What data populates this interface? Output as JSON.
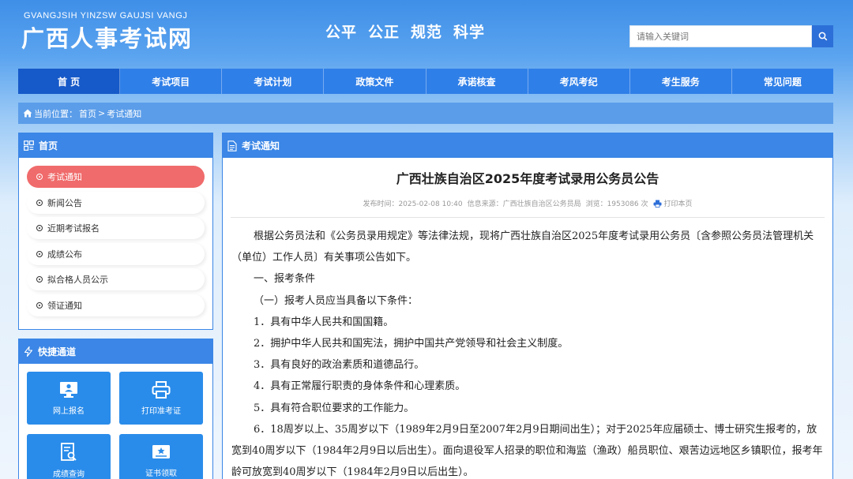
{
  "header": {
    "logo_en": "GVANGJSIH YINZSW GAUJSI VANGJ",
    "logo_cn": "广西人事考试网",
    "slogans": [
      "公平",
      "公正",
      "规范",
      "科学"
    ],
    "search_placeholder": "请输入关键词"
  },
  "nav": {
    "items": [
      "首 页",
      "考试项目",
      "考试计划",
      "政策文件",
      "承诺核查",
      "考风考纪",
      "考生服务",
      "常见问题"
    ],
    "active_index": 0
  },
  "breadcrumb": {
    "prefix": "当前位置：",
    "home": "首页",
    "sep": ">",
    "current": "考试通知"
  },
  "sidebar": {
    "title": "首页",
    "items": [
      "考试通知",
      "新闻公告",
      "近期考试报名",
      "成绩公布",
      "拟合格人员公示",
      "领证通知"
    ],
    "active_index": 0
  },
  "quick": {
    "title": "快捷通道",
    "items": [
      {
        "label": "网上报名",
        "icon": "monitor-user-icon"
      },
      {
        "label": "打印准考证",
        "icon": "printer-icon"
      },
      {
        "label": "成绩查询",
        "icon": "document-search-icon"
      },
      {
        "label": "证书领取",
        "icon": "certificate-icon"
      }
    ]
  },
  "main": {
    "section_title": "考试通知",
    "article_title": "广西壮族自治区2025年度考试录用公务员公告",
    "meta": {
      "publish_time": "发布时间：2025-02-08 10:40",
      "source": "信息来源：广西壮族自治区公务员局",
      "views": "浏览：1953086 次",
      "print": "打印本页"
    },
    "paragraphs": [
      "根据公务员法和《公务员录用规定》等法律法规，现将广西壮族自治区2025年度考试录用公务员〔含参照公务员法管理机关（单位）工作人员〕有关事项公告如下。",
      "一、报考条件",
      "（一）报考人员应当具备以下条件：",
      "1．具有中华人民共和国国籍。",
      "2．拥护中华人民共和国宪法，拥护中国共产党领导和社会主义制度。",
      "3．具有良好的政治素质和道德品行。",
      "4．具有正常履行职责的身体条件和心理素质。",
      "5．具有符合职位要求的工作能力。",
      "6．18周岁以上、35周岁以下（1989年2月9日至2007年2月9日期间出生）；对于2025年应届硕士、博士研究生报考的，放宽到40周岁以下（1984年2月9日以后出生）。面向退役军人招录的职位和海监（渔政）船员职位、艰苦边远地区乡镇职位，报考年龄可放宽到40周岁以下（1984年2月9日以后出生）。"
    ]
  },
  "colors": {
    "nav": "#2f7fe8",
    "nav_active": "#1659c9",
    "panel_head": "#3b86e6",
    "menu_active": "#f06b6b",
    "quick_button": "#2a8cea"
  }
}
